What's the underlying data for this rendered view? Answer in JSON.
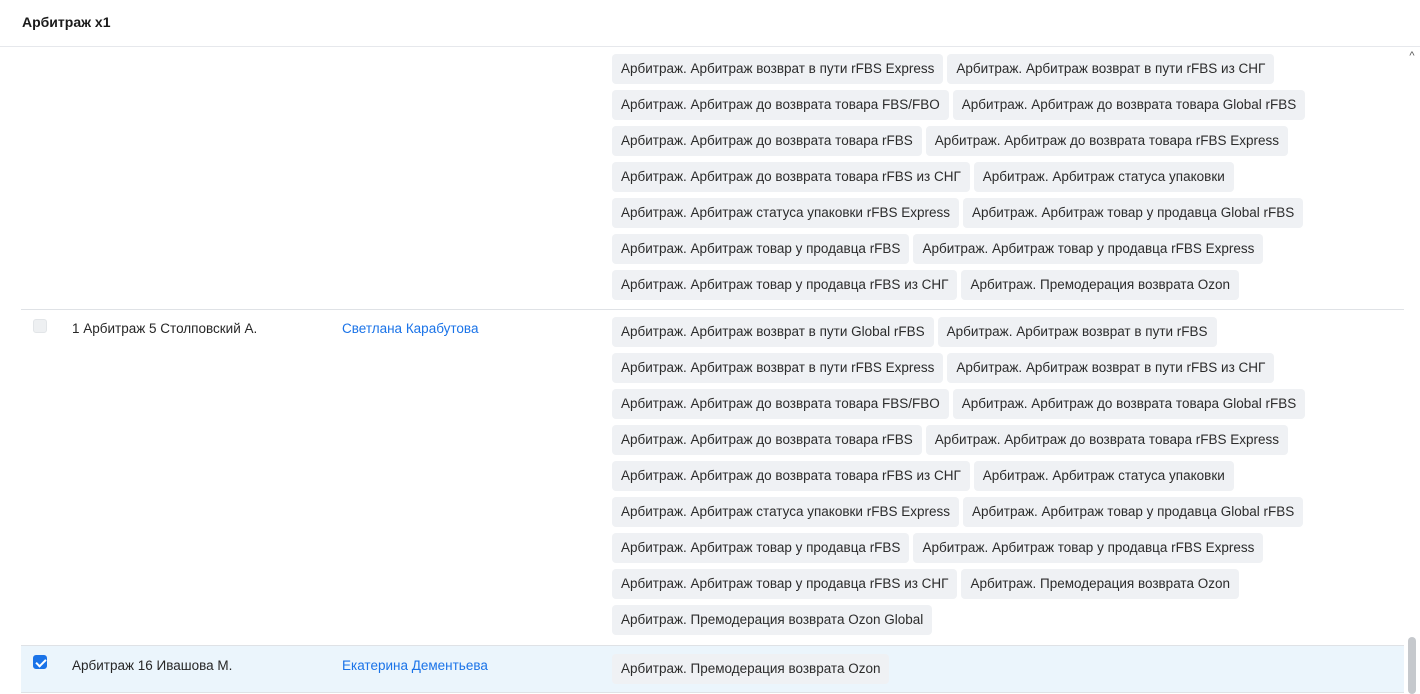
{
  "header": {
    "title": "Арбитраж x1"
  },
  "rows": [
    {
      "name": "",
      "user": "",
      "checked": null,
      "tags": [
        [
          "Арбитраж. Арбитраж возврат в пути rFBS Express",
          "Арбитраж. Арбитраж возврат в пути rFBS из СНГ"
        ],
        [
          "Арбитраж. Арбитраж до возврата товара FBS/FBO",
          "Арбитраж. Арбитраж до возврата товара Global rFBS"
        ],
        [
          "Арбитраж. Арбитраж до возврата товара rFBS",
          "Арбитраж. Арбитраж до возврата товара rFBS Express"
        ],
        [
          "Арбитраж. Арбитраж до возврата товара rFBS из СНГ",
          "Арбитраж. Арбитраж статуса упаковки"
        ],
        [
          "Арбитраж. Арбитраж статуса упаковки rFBS Express",
          "Арбитраж. Арбитраж товар у продавца Global rFBS"
        ],
        [
          "Арбитраж. Арбитраж товар у продавца rFBS",
          "Арбитраж. Арбитраж товар у продавца rFBS Express"
        ],
        [
          "Арбитраж. Арбитраж товар у продавца rFBS из СНГ",
          "Арбитраж. Премодерация возврата Ozon"
        ]
      ]
    },
    {
      "name": "1 Арбитраж 5 Столповский А.",
      "user": "Светлана Карабутова",
      "checked": false,
      "tags": [
        [
          "Арбитраж. Арбитраж возврат в пути Global rFBS",
          "Арбитраж. Арбитраж возврат в пути rFBS"
        ],
        [
          "Арбитраж. Арбитраж возврат в пути rFBS Express",
          "Арбитраж. Арбитраж возврат в пути rFBS из СНГ"
        ],
        [
          "Арбитраж. Арбитраж до возврата товара FBS/FBO",
          "Арбитраж. Арбитраж до возврата товара Global rFBS"
        ],
        [
          "Арбитраж. Арбитраж до возврата товара rFBS",
          "Арбитраж. Арбитраж до возврата товара rFBS Express"
        ],
        [
          "Арбитраж. Арбитраж до возврата товара rFBS из СНГ",
          "Арбитраж. Арбитраж статуса упаковки"
        ],
        [
          "Арбитраж. Арбитраж статуса упаковки rFBS Express",
          "Арбитраж. Арбитраж товар у продавца Global rFBS"
        ],
        [
          "Арбитраж. Арбитраж товар у продавца rFBS",
          "Арбитраж. Арбитраж товар у продавца rFBS Express"
        ],
        [
          "Арбитраж. Арбитраж товар у продавца rFBS из СНГ",
          "Арбитраж. Премодерация возврата Ozon"
        ],
        [
          "Арбитраж. Премодерация возврата Ozon Global"
        ]
      ]
    },
    {
      "name": "Арбитраж 16 Ивашова М.",
      "user": "Екатерина Дементьева",
      "checked": true,
      "tags": [
        [
          "Арбитраж. Премодерация возврата Ozon"
        ]
      ]
    }
  ],
  "icons": {
    "scroll_up": "chevron-up-icon",
    "checkbox": "checkbox-icon"
  },
  "colors": {
    "accent": "#1a73e8",
    "selected_row": "#ebf5fc",
    "tag_bg": "#eff1f4"
  }
}
